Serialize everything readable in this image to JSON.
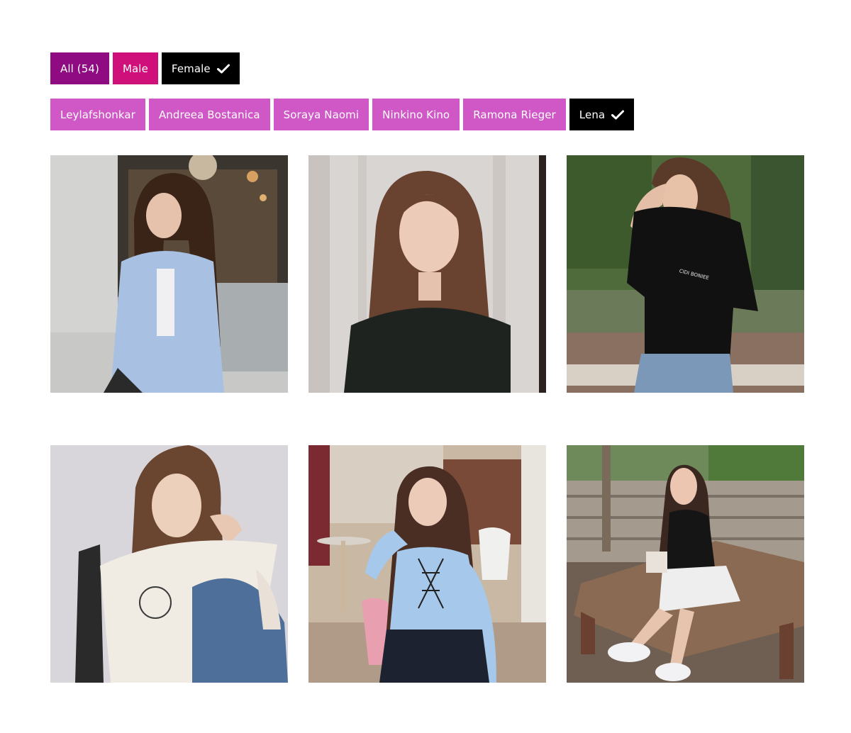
{
  "gender_filters": [
    {
      "label": "All (54)",
      "active": false
    },
    {
      "label": "Male",
      "active": false
    },
    {
      "label": "Female",
      "active": true
    }
  ],
  "name_filters": [
    {
      "label": "Leylafshonkar",
      "active": false
    },
    {
      "label": "Andreea Bostanica",
      "active": false
    },
    {
      "label": "Soraya Naomi",
      "active": false
    },
    {
      "label": "Ninkino Kino",
      "active": false
    },
    {
      "label": "Ramona Rieger",
      "active": false
    },
    {
      "label": "Lena",
      "active": true
    }
  ],
  "photo_text": {
    "shirt_print": "CIDI BONIEE"
  },
  "colors": {
    "all_chip": "#8e0b82",
    "male_chip": "#d0107a",
    "name_chip": "#cf57c6",
    "active_chip": "#000000"
  },
  "icons": {
    "selected": "check-icon"
  }
}
